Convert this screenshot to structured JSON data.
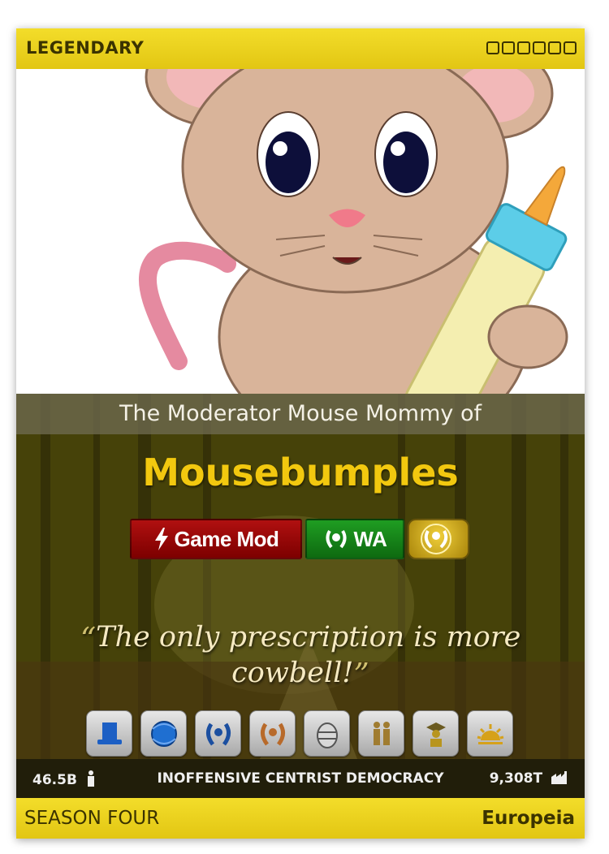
{
  "card": {
    "rarity": "LEGENDARY",
    "pretitle": "The Moderator Mouse Mommy of",
    "nation_name": "Mousebumples",
    "badges": {
      "mod_label": "Game Mod",
      "wa_label": "WA"
    },
    "motto": "The only prescription is more cowbell!",
    "motto_open_quote": "“",
    "motto_close_quote": "”",
    "stats": {
      "population": "46.5B",
      "government": "INOFFENSIVE CENTRIST DEMOCRACY",
      "gdp": "9,308T"
    },
    "season": "SEASON FOUR",
    "region": "Europeia",
    "trophy_icons": [
      "top-hat-icon",
      "globe-icon",
      "laurel-blue-icon",
      "laurel-bronze-icon",
      "egg-icon",
      "family-icon",
      "graduate-icon",
      "sunrise-icon"
    ],
    "colors": {
      "bar_yellow": "#e9d11e",
      "nation_gold": "#f2c80f",
      "mod_red": "#9a0a0a",
      "wa_green": "#178517"
    }
  }
}
